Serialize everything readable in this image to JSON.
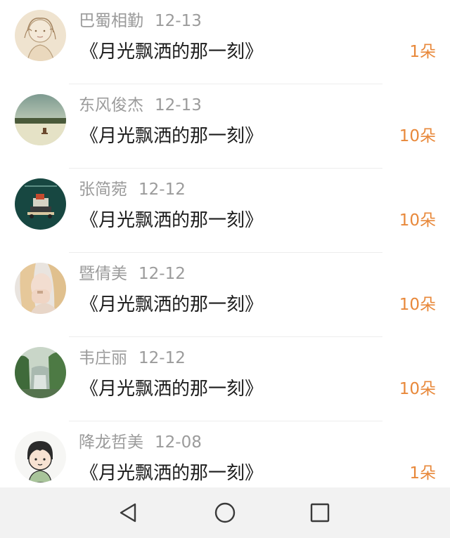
{
  "list": {
    "items": [
      {
        "name": "巴蜀相勤",
        "date": "12-13",
        "title": "《月光飘洒的那一刻》",
        "count": "1朵"
      },
      {
        "name": "东风俊杰",
        "date": "12-13",
        "title": "《月光飘洒的那一刻》",
        "count": "10朵"
      },
      {
        "name": "张简菀",
        "date": "12-12",
        "title": "《月光飘洒的那一刻》",
        "count": "10朵"
      },
      {
        "name": "暨倩美",
        "date": "12-12",
        "title": "《月光飘洒的那一刻》",
        "count": "10朵"
      },
      {
        "name": "韦庄丽",
        "date": "12-12",
        "title": "《月光飘洒的那一刻》",
        "count": "10朵"
      },
      {
        "name": "降龙哲美",
        "date": "12-08",
        "title": "《月光飘洒的那一刻》",
        "count": "1朵"
      }
    ]
  },
  "navbar": {
    "back": "back-triangle-icon",
    "home": "home-circle-icon",
    "recents": "recents-square-icon"
  },
  "colors": {
    "name_text": "#9b9b9b",
    "title_text": "#1c1c1c",
    "count_accent": "#e8883a",
    "navbar_bg": "#f2f2f2"
  }
}
